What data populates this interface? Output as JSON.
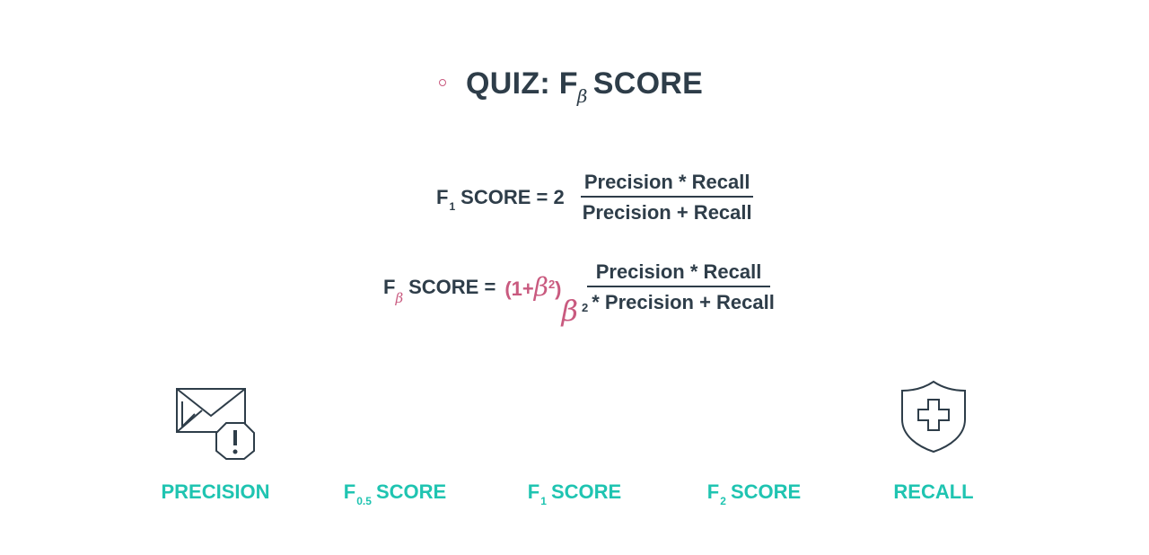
{
  "title": {
    "prefix": "QUIZ: F",
    "sub": "β",
    "suffix": "SCORE"
  },
  "f1_formula": {
    "lhs_f": "F",
    "lhs_sub": "1",
    "lhs_rest": "SCORE = 2",
    "numerator": "Precision * Recall",
    "denominator": "Precision + Recall"
  },
  "fbeta_formula": {
    "lhs_f": "F",
    "lhs_sub": "β",
    "lhs_rest": "SCORE =",
    "coef_open": "(1+",
    "coef_beta": "β",
    "coef_sq": "2",
    "coef_close": ")",
    "numerator": "Precision * Recall",
    "den_beta": "β",
    "den_sq": "2",
    "den_rest": "* Precision + Recall"
  },
  "labels": {
    "precision": "PRECISION",
    "f05_f": "F",
    "f05_sub": "0.5",
    "f05_rest": "SCORE",
    "f1_f": "F",
    "f1_sub": "1",
    "f1_rest": "SCORE",
    "f2_f": "F",
    "f2_sub": "2",
    "f2_rest": "SCORE",
    "recall": "RECALL"
  },
  "colors": {
    "text": "#2e3d49",
    "accent_pink": "#c95a7f",
    "accent_teal": "#1fc4b1"
  },
  "icons": {
    "precision": "mail-warning-icon",
    "recall": "shield-plus-icon"
  }
}
